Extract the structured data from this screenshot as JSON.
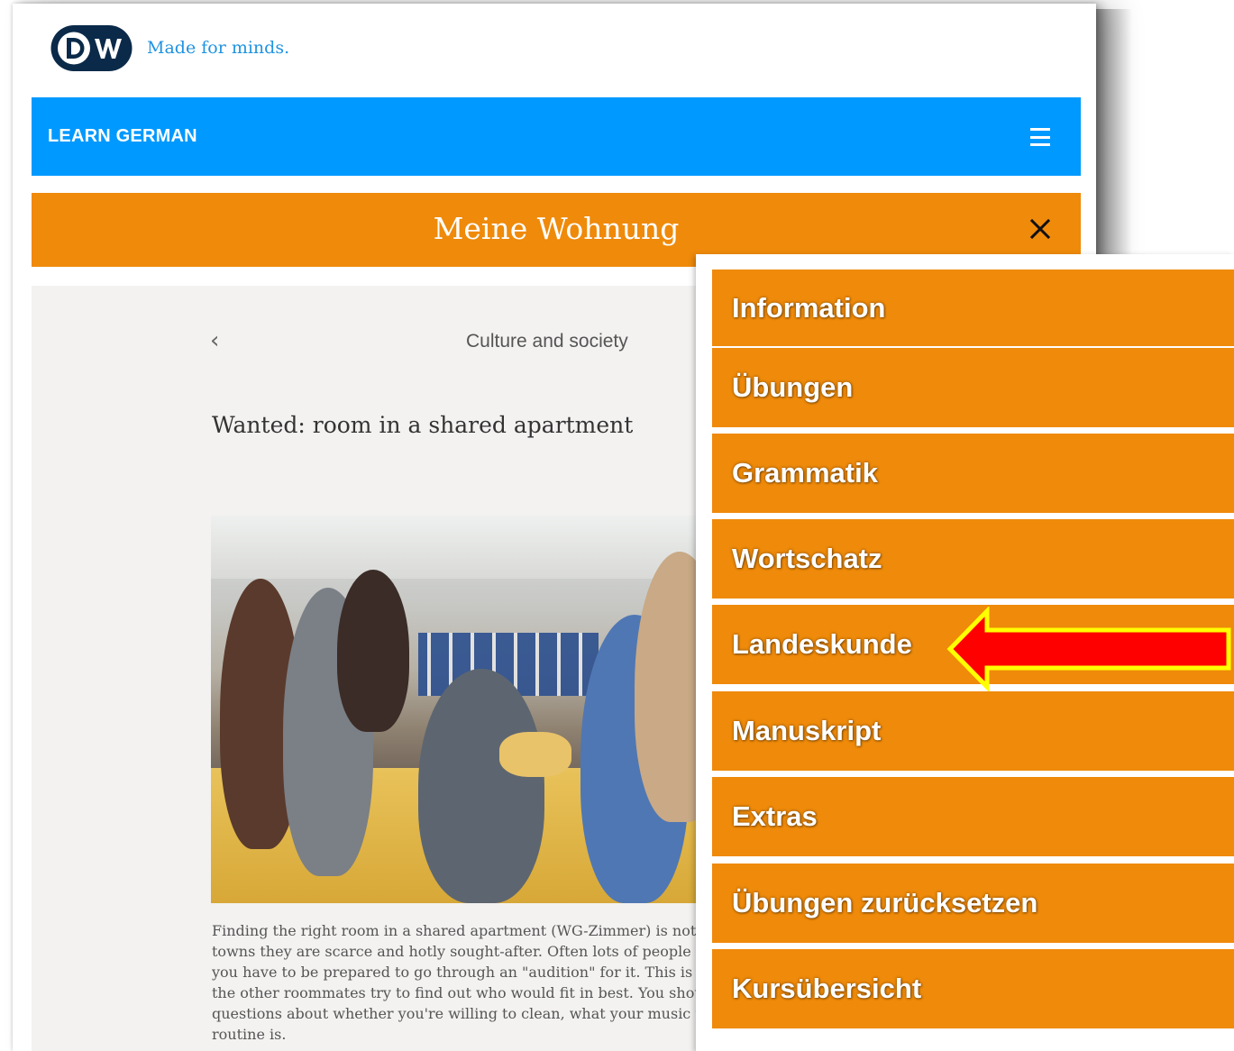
{
  "brand": {
    "logo_text": "DW",
    "tagline": "Made for minds."
  },
  "topbar": {
    "title": "LEARN GERMAN",
    "menu_icon": "hamburger-icon"
  },
  "lesson": {
    "title": "Meine Wohnung",
    "close_icon": "close-icon"
  },
  "article": {
    "back_icon": "chevron-left-icon",
    "category": "Culture and society",
    "title": "Wanted: room in a shared apartment",
    "body_lines": [
      "Finding the right room in a shared apartment (WG-Zimmer) is not ex",
      "towns they are scarce and hotly sought-after. Often lots of people are",
      "you have to be prepared to go through an \"audition\" for it. This is a k",
      "the other roommates try to find out who would fit in best. You shoul",
      "questions about whether you're willing to clean, what your music ta",
      "routine is."
    ]
  },
  "menu": {
    "items": [
      {
        "label": "Information"
      },
      {
        "label": "Übungen"
      },
      {
        "label": "Grammatik"
      },
      {
        "label": "Wortschatz"
      },
      {
        "label": "Landeskunde"
      },
      {
        "label": "Manuskript"
      },
      {
        "label": "Extras"
      },
      {
        "label": "Übungen zurücksetzen"
      },
      {
        "label": "Kursübersicht"
      }
    ]
  },
  "colors": {
    "topbar": "#0099ff",
    "orange": "#ef8a0a",
    "arrow_fill": "#ff0000",
    "arrow_stroke": "#ffff00",
    "tagline": "#1f93e0"
  }
}
